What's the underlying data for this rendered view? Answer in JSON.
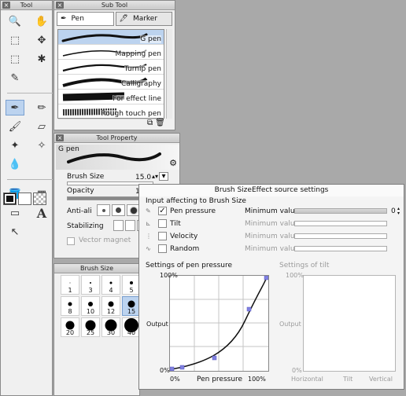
{
  "tool_panel": {
    "title": "Tool",
    "close": "×"
  },
  "subtool": {
    "title": "Sub Tool",
    "close": "×",
    "tabs": [
      {
        "label": "Pen"
      },
      {
        "label": "Marker"
      }
    ],
    "brushes": [
      {
        "label": "G pen"
      },
      {
        "label": "Mapping pen"
      },
      {
        "label": "Turnip pen"
      },
      {
        "label": "Calligraphy"
      },
      {
        "label": "For effect line"
      },
      {
        "label": "Rough touch pen"
      }
    ]
  },
  "tool_property": {
    "title": "Tool Property",
    "close": "×",
    "brush_name": "G pen",
    "brush_size_label": "Brush Size",
    "brush_size_value": "15.0",
    "opacity_label": "Opacity",
    "opacity_value": "1",
    "antialias_label": "Anti-ali",
    "stabilizing_label": "Stabilizing",
    "vector_magnet_label": "Vector magnet"
  },
  "brush_size_panel": {
    "title": "Brush Size",
    "sizes": [
      "1",
      "3",
      "4",
      "5",
      "8",
      "10",
      "12",
      "15",
      "20",
      "25",
      "30",
      "40"
    ]
  },
  "dialog": {
    "title": "Brush SizeEffect source settings",
    "close": "×",
    "inputs_title": "Input affecting to Brush Size",
    "inputs": [
      {
        "label": "Pen pressure",
        "checked": true
      },
      {
        "label": "Tilt",
        "checked": false
      },
      {
        "label": "Velocity",
        "checked": false
      },
      {
        "label": "Random",
        "checked": false
      }
    ],
    "minimum_label": "Minimum value",
    "minimum_value": "0",
    "pressure_graph": {
      "title": "Settings of pen pressure",
      "y_top": "100%",
      "y_bottom": "0%",
      "y_label": "Output",
      "x_left": "0%",
      "x_label": "Pen pressure",
      "x_right": "100%"
    },
    "tilt_graph": {
      "title": "Settings of tilt",
      "y_top": "100%",
      "y_bottom": "0%",
      "y_label": "Output",
      "x_labels": [
        "Horizontal",
        "Tilt",
        "Vertical"
      ]
    }
  },
  "colors": {
    "selection": "#bcd3ef",
    "curve_handle": "#8080e0"
  }
}
